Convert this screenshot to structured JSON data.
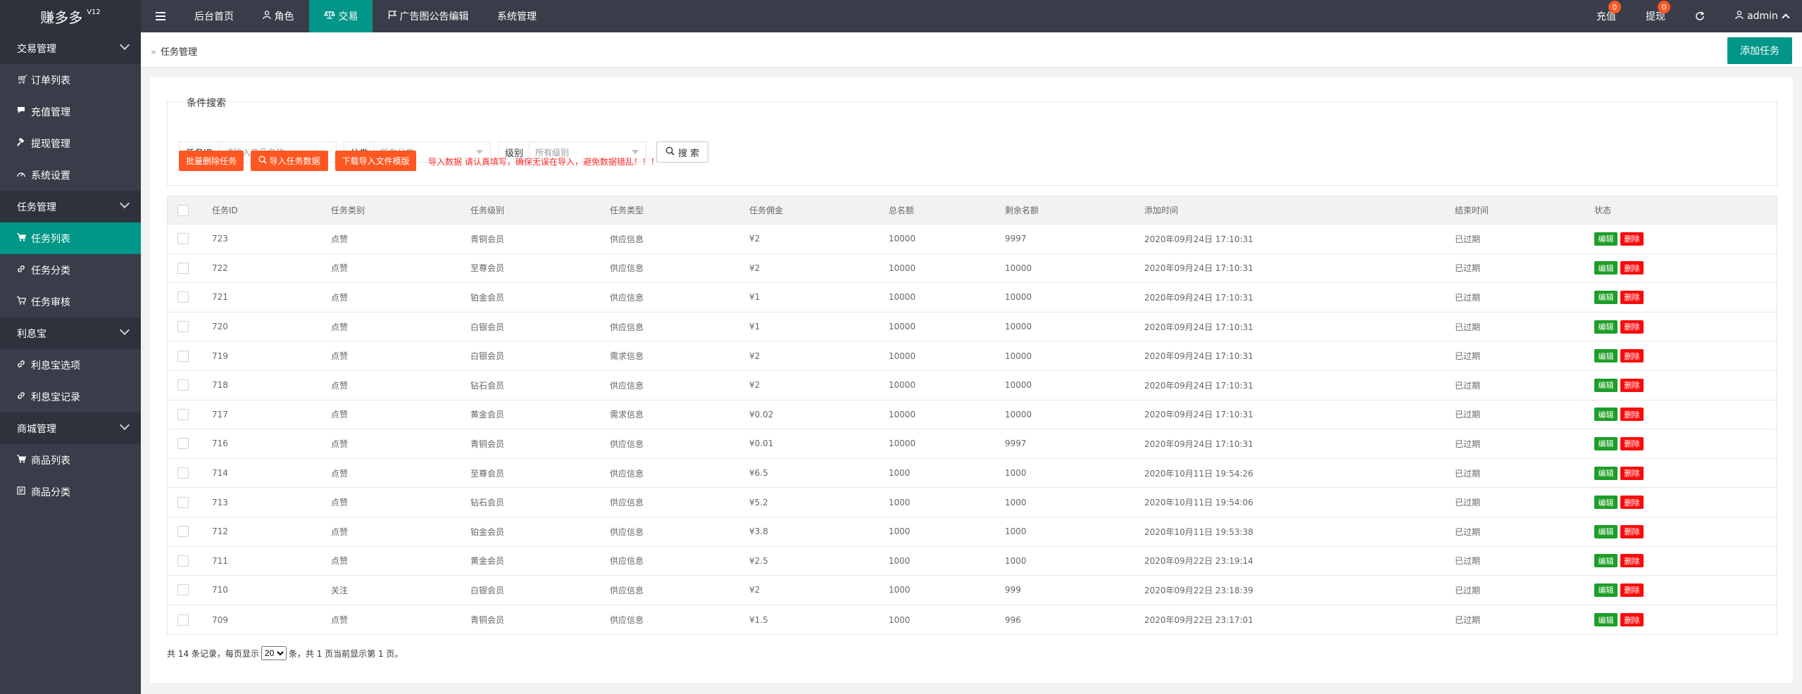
{
  "app": {
    "logo": "赚多多",
    "version": "V12"
  },
  "topnav": {
    "menu_icon": "hamburger-icon",
    "items": [
      {
        "label": "后台首页",
        "icon": ""
      },
      {
        "label": "角色",
        "icon": "user-icon"
      },
      {
        "label": "交易",
        "icon": "scale-icon",
        "active": true
      },
      {
        "label": "广告图公告编辑",
        "icon": "flag-icon"
      },
      {
        "label": "系统管理",
        "icon": ""
      }
    ],
    "right": {
      "recharge_label": "充值",
      "recharge_badge": "0",
      "withdraw_label": "提现",
      "withdraw_badge": "0",
      "refresh_icon": "refresh-icon",
      "user_label": "admin"
    }
  },
  "sidebar": {
    "groups": [
      {
        "label": "交易管理",
        "items": [
          {
            "label": "订单列表",
            "icon": "cart-icon"
          },
          {
            "label": "充值管理",
            "icon": "chat-icon"
          },
          {
            "label": "提现管理",
            "icon": "hammer-icon"
          },
          {
            "label": "系统设置",
            "icon": "dashboard-icon"
          }
        ]
      },
      {
        "label": "任务管理",
        "items": [
          {
            "label": "任务列表",
            "icon": "cart-icon",
            "active": true
          },
          {
            "label": "任务分类",
            "icon": "link-icon"
          },
          {
            "label": "任务审核",
            "icon": "cart-icon"
          }
        ]
      },
      {
        "label": "利息宝",
        "items": [
          {
            "label": "利息宝选项",
            "icon": "link-icon"
          },
          {
            "label": "利息宝记录",
            "icon": "link-icon"
          }
        ]
      },
      {
        "label": "商城管理",
        "items": [
          {
            "label": "商品列表",
            "icon": "cart-icon"
          },
          {
            "label": "商品分类",
            "icon": "list-icon"
          }
        ]
      }
    ]
  },
  "breadcrumb": {
    "label": "任务管理"
  },
  "add_button": "添加任务",
  "search": {
    "legend": "条件搜索",
    "task_id_label": "任务ID",
    "task_id_placeholder": "请输入商品名称",
    "category_label": "分类",
    "category_value": "所有分类",
    "level_label": "级别",
    "level_value": "所有级别",
    "search_button": "搜 索"
  },
  "actions": {
    "batch_delete": "批量删除任务",
    "import_data": "导入任务数据",
    "download_template": "下载导入文件模版",
    "warning": "导入数据 请认真填写，确保无误在导入，避免数据错乱！！！"
  },
  "table": {
    "headers": [
      "任务ID",
      "任务类别",
      "任务级别",
      "任务类型",
      "任务佣金",
      "总名额",
      "剩余名额",
      "添加时间",
      "结束时间",
      "状态"
    ],
    "edit_label": "编辑",
    "delete_label": "删除",
    "rows": [
      [
        "723",
        "点赞",
        "青铜会员",
        "供应信息",
        "¥2",
        "10000",
        "9997",
        "2020年09月24日 17:10:31",
        "已过期"
      ],
      [
        "722",
        "点赞",
        "至尊会员",
        "供应信息",
        "¥2",
        "10000",
        "10000",
        "2020年09月24日 17:10:31",
        "已过期"
      ],
      [
        "721",
        "点赞",
        "铂金会员",
        "供应信息",
        "¥1",
        "10000",
        "10000",
        "2020年09月24日 17:10:31",
        "已过期"
      ],
      [
        "720",
        "点赞",
        "白银会员",
        "供应信息",
        "¥1",
        "10000",
        "10000",
        "2020年09月24日 17:10:31",
        "已过期"
      ],
      [
        "719",
        "点赞",
        "白银会员",
        "需求信息",
        "¥2",
        "10000",
        "10000",
        "2020年09月24日 17:10:31",
        "已过期"
      ],
      [
        "718",
        "点赞",
        "钻石会员",
        "供应信息",
        "¥2",
        "10000",
        "10000",
        "2020年09月24日 17:10:31",
        "已过期"
      ],
      [
        "717",
        "点赞",
        "黄金会员",
        "需求信息",
        "¥0.02",
        "10000",
        "10000",
        "2020年09月24日 17:10:31",
        "已过期"
      ],
      [
        "716",
        "点赞",
        "青铜会员",
        "供应信息",
        "¥0.01",
        "10000",
        "9997",
        "2020年09月24日 17:10:31",
        "已过期"
      ],
      [
        "714",
        "点赞",
        "至尊会员",
        "供应信息",
        "¥6.5",
        "1000",
        "1000",
        "2020年10月11日 19:54:26",
        "已过期"
      ],
      [
        "713",
        "点赞",
        "钻石会员",
        "供应信息",
        "¥5.2",
        "1000",
        "1000",
        "2020年10月11日 19:54:06",
        "已过期"
      ],
      [
        "712",
        "点赞",
        "铂金会员",
        "供应信息",
        "¥3.8",
        "1000",
        "1000",
        "2020年10月11日 19:53:38",
        "已过期"
      ],
      [
        "711",
        "点赞",
        "黄金会员",
        "供应信息",
        "¥2.5",
        "1000",
        "1000",
        "2020年09月22日 23:19:14",
        "已过期"
      ],
      [
        "710",
        "关注",
        "白银会员",
        "供应信息",
        "¥2",
        "1000",
        "999",
        "2020年09月22日 23:18:39",
        "已过期"
      ],
      [
        "709",
        "点赞",
        "青铜会员",
        "供应信息",
        "¥1.5",
        "1000",
        "996",
        "2020年09月22日 23:17:01",
        "已过期"
      ]
    ]
  },
  "pager": {
    "prefix": "共 14 条记录，每页显示",
    "page_size": "20",
    "suffix": "条，共 1 页当前显示第 1 页。"
  }
}
